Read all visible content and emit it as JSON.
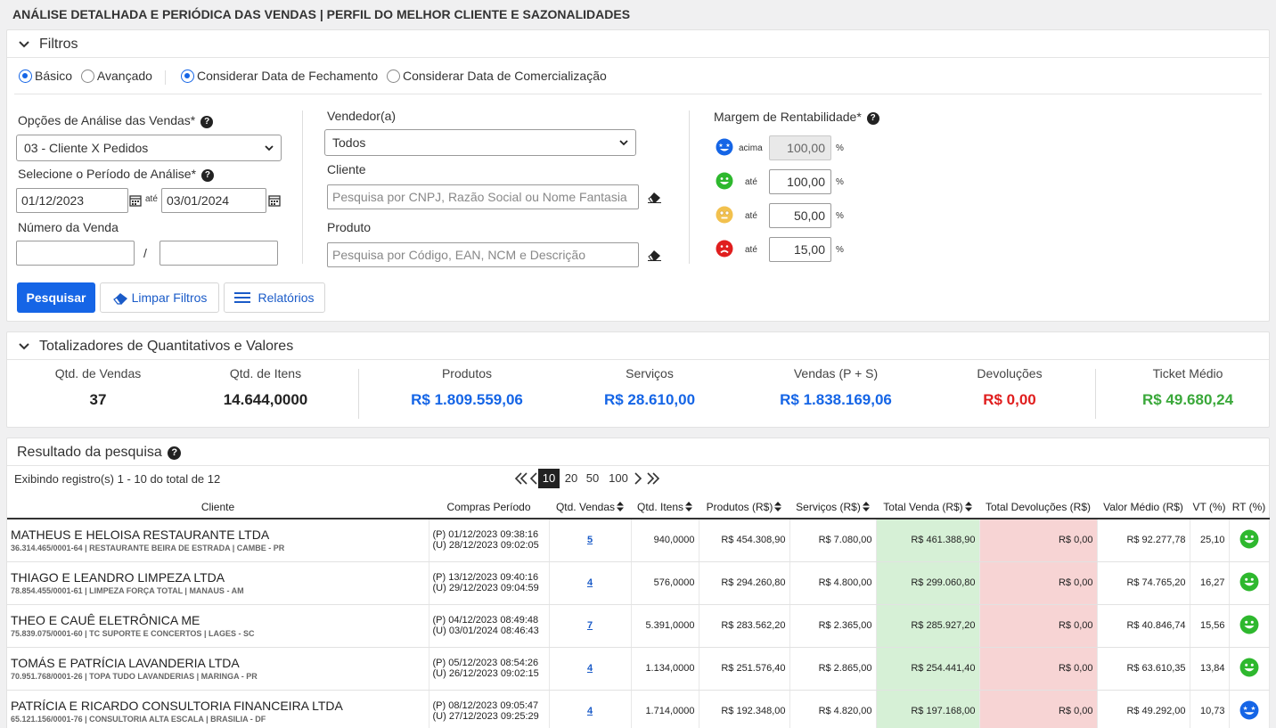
{
  "page": {
    "title": "ANÁLISE DETALHADA E PERIÓDICA DAS VENDAS | PERFIL DO MELHOR CLIENTE E SAZONALIDADES"
  },
  "filters": {
    "title": "Filtros",
    "mode_basic": "Básico",
    "mode_advanced": "Avançado",
    "date_close": "Considerar Data de Fechamento",
    "date_comm": "Considerar Data de Comercialização",
    "analysis_label": "Opções de Análise das Vendas*",
    "analysis_value": "03 - Cliente X Pedidos",
    "period_label": "Selecione o Período de Análise*",
    "date_from": "01/12/2023",
    "ate": "até",
    "date_to": "03/01/2024",
    "sale_number_label": "Número da Venda",
    "slash": "/",
    "seller_label": "Vendedor(a)",
    "seller_value": "Todos",
    "client_label": "Cliente",
    "client_placeholder": "Pesquisa por CNPJ, Razão Social ou Nome Fantasia",
    "product_label": "Produto",
    "product_placeholder": "Pesquisa por Código, EAN, NCM e Descrição",
    "margin_label": "Margem de Rentabilidade*",
    "margins": [
      {
        "cond": "acima",
        "value": "100,00",
        "unit": "%",
        "icon": "star-eyes-face-icon",
        "color": "#1565e6"
      },
      {
        "cond": "até",
        "value": "100,00",
        "unit": "%",
        "icon": "smile-face-icon",
        "color": "#2eb82e"
      },
      {
        "cond": "até",
        "value": "50,00",
        "unit": "%",
        "icon": "neutral-face-icon",
        "color": "#f2c14e"
      },
      {
        "cond": "até",
        "value": "15,00",
        "unit": "%",
        "icon": "sad-face-icon",
        "color": "#e01e1e"
      }
    ],
    "btn_search": "Pesquisar",
    "btn_clear": "Limpar Filtros",
    "btn_reports": "Relatórios"
  },
  "totals": {
    "title": "Totalizadores de Quantitativos e Valores",
    "items": [
      {
        "label": "Qtd. de Vendas",
        "value": "37",
        "color": "#222222"
      },
      {
        "label": "Qtd. de Itens",
        "value": "14.644,0000",
        "color": "#222222"
      },
      {
        "label": "Produtos",
        "value": "R$ 1.809.559,06",
        "color": "#1565e6"
      },
      {
        "label": "Serviços",
        "value": "R$ 28.610,00",
        "color": "#1565e6"
      },
      {
        "label": "Vendas (P + S)",
        "value": "R$ 1.838.169,06",
        "color": "#1565e6"
      },
      {
        "label": "Devoluções",
        "value": "R$ 0,00",
        "color": "#e01e1e"
      },
      {
        "label": "Ticket Médio",
        "value": "R$ 49.680,24",
        "color": "#3aa83a"
      }
    ]
  },
  "results": {
    "title": "Resultado da pesquisa",
    "showing": "Exibindo registro(s) 1 - 10 do total de 12",
    "page_sizes": [
      "10",
      "20",
      "50",
      "100"
    ],
    "columns": [
      "Cliente",
      "Compras Período",
      "Qtd. Vendas",
      "Qtd. Itens",
      "Produtos (R$)",
      "Serviços (R$)",
      "Total Venda (R$)",
      "Total Devoluções (R$)",
      "Valor Médio (R$)",
      "VT (%)",
      "RT (%)"
    ],
    "rows": [
      {
        "name": "MATHEUS E HELOISA RESTAURANTE LTDA",
        "sub": "36.314.465/0001-64 | RESTAURANTE BEIRA DE ESTRADA | CAMBE - PR",
        "p": "(P) 01/12/2023 09:38:16",
        "u": "(U) 28/12/2023 09:02:05",
        "qv": "5",
        "qi": "940,0000",
        "prod": "R$ 454.308,90",
        "serv": "R$ 7.080,00",
        "total": "R$ 461.388,90",
        "dev": "R$ 0,00",
        "avg": "R$ 92.277,78",
        "vt": "25,10",
        "rt": "smile-face-icon"
      },
      {
        "name": "THIAGO E LEANDRO LIMPEZA LTDA",
        "sub": "78.854.455/0001-61 | LIMPEZA FORÇA TOTAL | MANAUS - AM",
        "p": "(P) 13/12/2023 09:40:16",
        "u": "(U) 29/12/2023 09:04:59",
        "qv": "4",
        "qi": "576,0000",
        "prod": "R$ 294.260,80",
        "serv": "R$ 4.800,00",
        "total": "R$ 299.060,80",
        "dev": "R$ 0,00",
        "avg": "R$ 74.765,20",
        "vt": "16,27",
        "rt": "smile-face-icon"
      },
      {
        "name": "THEO E CAUÊ ELETRÔNICA ME",
        "sub": "75.839.075/0001-60 | TC SUPORTE E CONCERTOS | LAGES - SC",
        "p": "(P) 04/12/2023 08:49:48",
        "u": "(U) 03/01/2024 08:46:43",
        "qv": "7",
        "qi": "5.391,0000",
        "prod": "R$ 283.562,20",
        "serv": "R$ 2.365,00",
        "total": "R$ 285.927,20",
        "dev": "R$ 0,00",
        "avg": "R$ 40.846,74",
        "vt": "15,56",
        "rt": "smile-face-icon"
      },
      {
        "name": "TOMÁS E PATRÍCIA LAVANDERIA LTDA",
        "sub": "70.951.768/0001-26 | TOPA TUDO LAVANDERIAS | MARINGA - PR",
        "p": "(P) 05/12/2023 08:54:26",
        "u": "(U) 26/12/2023 09:02:15",
        "qv": "4",
        "qi": "1.134,0000",
        "prod": "R$ 251.576,40",
        "serv": "R$ 2.865,00",
        "total": "R$ 254.441,40",
        "dev": "R$ 0,00",
        "avg": "R$ 63.610,35",
        "vt": "13,84",
        "rt": "smile-face-icon"
      },
      {
        "name": "PATRÍCIA E RICARDO CONSULTORIA FINANCEIRA LTDA",
        "sub": "65.121.156/0001-76 | CONSULTORIA ALTA ESCALA | BRASILIA - DF",
        "p": "(P) 08/12/2023 09:05:47",
        "u": "(U) 27/12/2023 09:25:29",
        "qv": "4",
        "qi": "1.714,0000",
        "prod": "R$ 192.348,00",
        "serv": "R$ 4.820,00",
        "total": "R$ 197.168,00",
        "dev": "R$ 0,00",
        "avg": "R$ 49.292,00",
        "vt": "10,73",
        "rt": "star-eyes-face-icon"
      }
    ]
  }
}
